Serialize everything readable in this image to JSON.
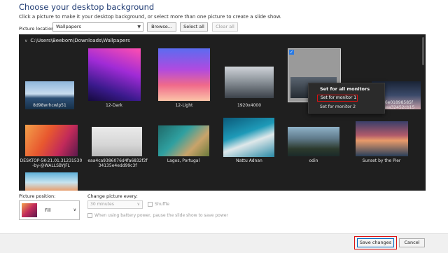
{
  "header": {
    "title": "Choose your desktop background",
    "subtitle": "Click a picture to make it your desktop background, or select more than one picture to create a slide show."
  },
  "location": {
    "label": "Picture location:",
    "value": "Wallpapers",
    "browse": "Browse...",
    "select_all": "Select all",
    "clear_all": "Clear all"
  },
  "gallery": {
    "path": "C:\\Users\\Beebom\\Downloads\\Wallpapers",
    "captions": {
      "c1": "8d98wrhcwlp51",
      "c2": "12-Dark",
      "c3": "12-Light",
      "c4": "1920x4000",
      "c5a": "56e01898585f",
      "c5b": "eaea32452cb15",
      "c6a": "DESKTOP-5K-21.01.31231530",
      "c6b": "-by-@WALLSBYJFL",
      "c7a": "eaa4ca9386076d4fa6832f2f",
      "c7b": "34135e4edd99c3f",
      "c8": "Lagos, Portugal",
      "c9": "Nattu Adnan",
      "c10": "odin",
      "c11": "Sunset by the Pier"
    }
  },
  "context_menu": {
    "header": "Set for all monitors",
    "item1": "Set for monitor 1",
    "item2": "Set for monitor 2"
  },
  "options": {
    "position_label": "Picture position:",
    "position_value": "Fill",
    "change_label": "Change picture every:",
    "interval": "30 minutes",
    "shuffle": "Shuffle",
    "battery": "When using battery power, pause the slide show to save power"
  },
  "footer": {
    "save": "Save changes",
    "cancel": "Cancel"
  },
  "colors": {
    "highlight": "#dd1111",
    "gallery_bg": "#1f1f1f"
  }
}
